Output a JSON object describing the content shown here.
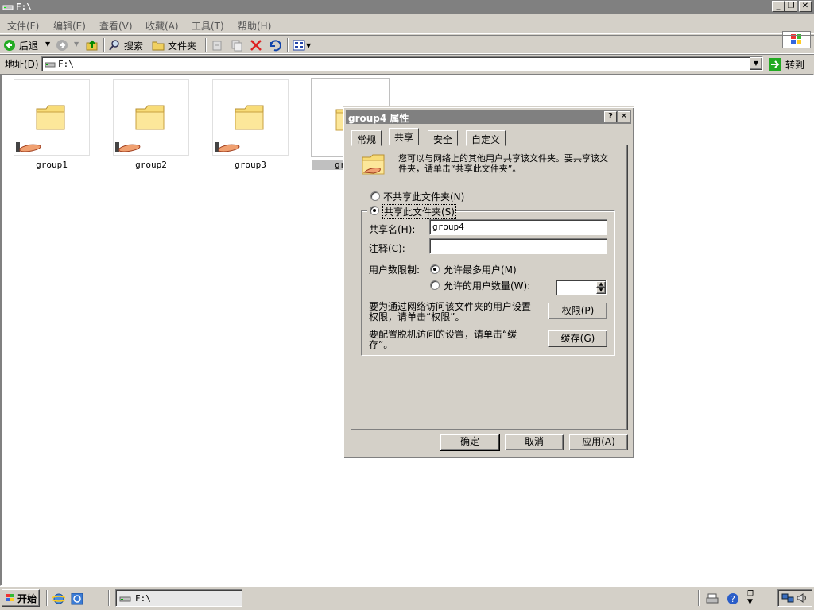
{
  "window": {
    "title": "F:\\"
  },
  "menu": [
    {
      "label": "文件(F)"
    },
    {
      "label": "编辑(E)"
    },
    {
      "label": "查看(V)"
    },
    {
      "label": "收藏(A)"
    },
    {
      "label": "工具(T)"
    },
    {
      "label": "帮助(H)"
    }
  ],
  "toolbar": {
    "back": "后退",
    "search": "搜索",
    "folders": "文件夹"
  },
  "address": {
    "label": "地址(D)",
    "value": "F:\\",
    "go": "转到"
  },
  "folders": [
    {
      "name": "group1"
    },
    {
      "name": "group2"
    },
    {
      "name": "group3"
    },
    {
      "name": "group4"
    }
  ],
  "dialog": {
    "title": "group4 属性",
    "tabs": [
      {
        "label": "常规"
      },
      {
        "label": "共享"
      },
      {
        "label": "安全"
      },
      {
        "label": "自定义"
      }
    ],
    "description": "您可以与网络上的其他用户共享该文件夹。要共享该文件夹，请单击“共享此文件夹”。",
    "no_share": "不共享此文件夹(N)",
    "share": "共享此文件夹(S)",
    "share_name_label": "共享名(H):",
    "share_name_value": "group4",
    "comment_label": "注释(C):",
    "comment_value": "",
    "user_limit_label": "用户数限制:",
    "max_users": "允许最多用户(M)",
    "allowed_users": "允许的用户数量(W):",
    "permissions_text": "要为通过网络访问该文件夹的用户设置权限，请单击“权限”。",
    "permissions_btn": "权限(P)",
    "caching_text": "要配置脱机访问的设置，请单击“缓存”。",
    "caching_btn": "缓存(G)",
    "ok": "确定",
    "cancel": "取消",
    "apply": "应用(A)"
  },
  "taskbar": {
    "start": "开始",
    "task": "F:\\"
  }
}
